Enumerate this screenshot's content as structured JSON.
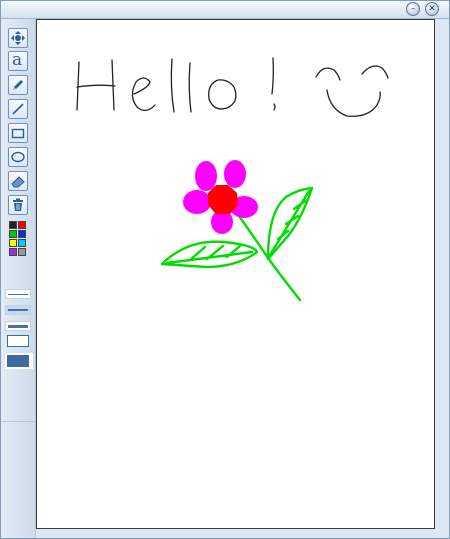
{
  "window": {
    "title": "",
    "controls": {
      "minimize_icon": "minimize-icon",
      "close_icon": "close-icon"
    }
  },
  "toolbar": {
    "tools": [
      "move-tool",
      "text-tool",
      "pencil-tool",
      "line-tool",
      "rectangle-tool",
      "ellipse-tool",
      "eraser-tool",
      "trash-tool"
    ],
    "text_tool_glyph": "a",
    "palette": [
      "#222222",
      "#ff0000",
      "#00cc00",
      "#0033cc",
      "#ffff00",
      "#00ccff",
      "#9933cc",
      "#999999"
    ],
    "line_widths": [
      1,
      2,
      3
    ],
    "fill_modes": [
      "outline",
      "filled"
    ]
  },
  "canvas": {
    "drawing_colors": {
      "text_stroke": "#222222",
      "petals": "#ff00ff",
      "flower_center": "#ff0000",
      "stem_leaves": "#00dd00"
    }
  }
}
